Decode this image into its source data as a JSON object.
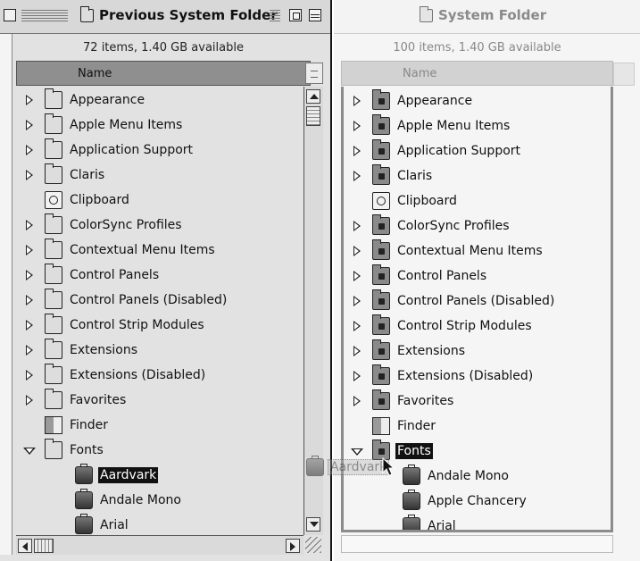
{
  "left_window": {
    "title": "Previous System Folder",
    "info": "72 items, 1.40 GB available",
    "column_header": "Name",
    "items": [
      {
        "label": "Appearance",
        "icon": "folder-icon",
        "expand": "closed"
      },
      {
        "label": "Apple Menu Items",
        "icon": "folder-icon",
        "expand": "closed"
      },
      {
        "label": "Application Support",
        "icon": "folder-icon",
        "expand": "closed"
      },
      {
        "label": "Claris",
        "icon": "folder-icon",
        "expand": "closed"
      },
      {
        "label": "Clipboard",
        "icon": "clipboard-icon",
        "expand": "none"
      },
      {
        "label": "ColorSync Profiles",
        "icon": "folder-icon",
        "expand": "closed"
      },
      {
        "label": "Contextual Menu Items",
        "icon": "folder-icon",
        "expand": "closed"
      },
      {
        "label": "Control Panels",
        "icon": "folder-icon",
        "expand": "closed"
      },
      {
        "label": "Control Panels (Disabled)",
        "icon": "folder-icon",
        "expand": "closed"
      },
      {
        "label": "Control Strip Modules",
        "icon": "folder-icon",
        "expand": "closed"
      },
      {
        "label": "Extensions",
        "icon": "folder-icon",
        "expand": "closed"
      },
      {
        "label": "Extensions (Disabled)",
        "icon": "folder-icon",
        "expand": "closed"
      },
      {
        "label": "Favorites",
        "icon": "folder-icon",
        "expand": "closed"
      },
      {
        "label": "Finder",
        "icon": "finder-icon",
        "expand": "none"
      },
      {
        "label": "Fonts",
        "icon": "folder-icon",
        "expand": "open"
      },
      {
        "label": "Aardvark",
        "icon": "font-suitcase-icon",
        "expand": "child",
        "selected": true
      },
      {
        "label": "Andale Mono",
        "icon": "font-suitcase-icon",
        "expand": "child"
      },
      {
        "label": "Arial",
        "icon": "font-suitcase-icon",
        "expand": "child"
      }
    ]
  },
  "right_window": {
    "title": "System Folder",
    "info": "100 items, 1.40 GB available",
    "column_header": "Name",
    "items": [
      {
        "label": "Appearance",
        "icon": "appearance-folder-icon",
        "expand": "closed"
      },
      {
        "label": "Apple Menu Items",
        "icon": "apple-menu-folder-icon",
        "expand": "closed"
      },
      {
        "label": "Application Support",
        "icon": "app-support-folder-icon",
        "expand": "closed"
      },
      {
        "label": "Claris",
        "icon": "folder-icon",
        "expand": "closed"
      },
      {
        "label": "Clipboard",
        "icon": "clipboard-icon",
        "expand": "none"
      },
      {
        "label": "ColorSync Profiles",
        "icon": "colorsync-folder-icon",
        "expand": "closed"
      },
      {
        "label": "Contextual Menu Items",
        "icon": "contextual-menu-folder-icon",
        "expand": "closed"
      },
      {
        "label": "Control Panels",
        "icon": "control-panels-folder-icon",
        "expand": "closed"
      },
      {
        "label": "Control Panels (Disabled)",
        "icon": "control-panels-folder-icon",
        "expand": "closed"
      },
      {
        "label": "Control Strip Modules",
        "icon": "control-strip-folder-icon",
        "expand": "closed"
      },
      {
        "label": "Extensions",
        "icon": "extensions-folder-icon",
        "expand": "closed"
      },
      {
        "label": "Extensions (Disabled)",
        "icon": "extensions-folder-icon",
        "expand": "closed"
      },
      {
        "label": "Favorites",
        "icon": "favorites-folder-icon",
        "expand": "closed"
      },
      {
        "label": "Finder",
        "icon": "finder-icon",
        "expand": "none"
      },
      {
        "label": "Fonts",
        "icon": "fonts-folder-icon",
        "expand": "open",
        "selected": true
      },
      {
        "label": "Andale Mono",
        "icon": "font-suitcase-icon",
        "expand": "child"
      },
      {
        "label": "Apple Chancery",
        "icon": "font-suitcase-icon",
        "expand": "child"
      },
      {
        "label": "Arial",
        "icon": "font-suitcase-icon",
        "expand": "child"
      }
    ]
  },
  "drag_ghost": {
    "label": "Aardvark",
    "icon": "font-suitcase-icon"
  },
  "colors": {
    "selection": "#111111",
    "left_header": "#8f8f8f",
    "right_frame": "#8c8c8c"
  }
}
